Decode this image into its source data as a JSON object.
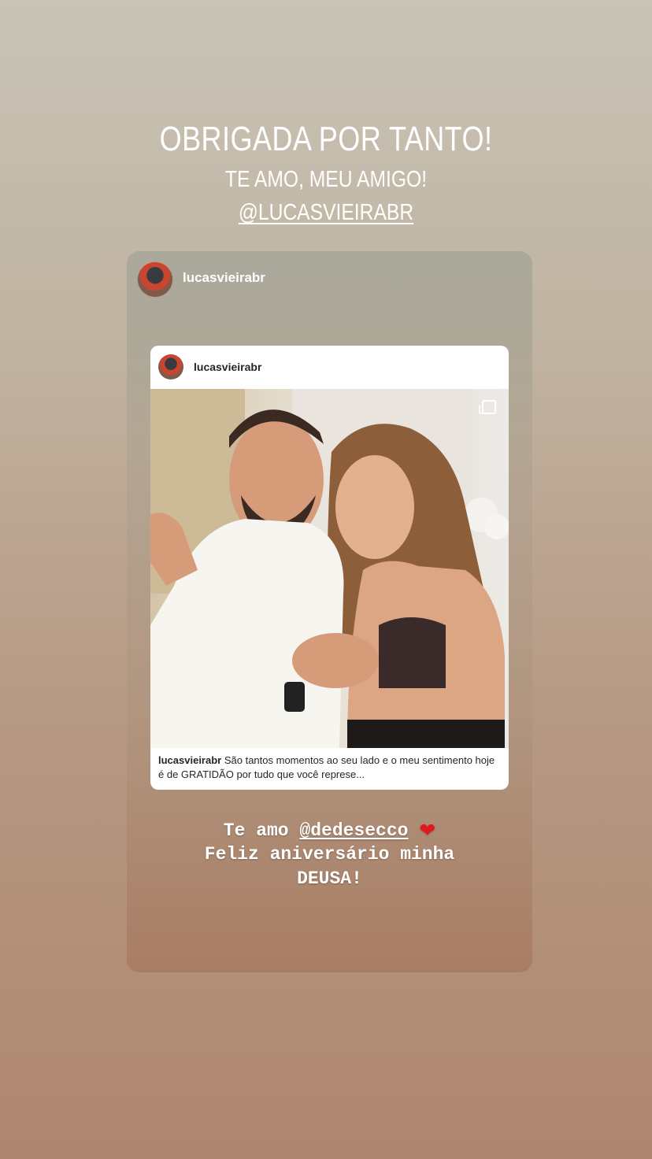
{
  "story": {
    "headline": "OBRIGADA POR TANTO!",
    "subline": "TE AMO, MEU AMIGO!",
    "mention": "@LUCASVIEIRABR"
  },
  "shared_post": {
    "username": "lucasvieirabr",
    "post_username": "lucasvieirabr",
    "caption_user": "lucasvieirabr",
    "caption_text": "São tantos momentos ao seu lado e o meu sentimento hoje é de GRATIDÃO por tudo que você represe...",
    "message_line1_prefix": "Te amo ",
    "message_mention": "@dedesecco",
    "message_heart": "❤",
    "message_line2": "Feliz aniversário minha",
    "message_line3": "DEUSA!"
  },
  "colors": {
    "heart": "#e0191d",
    "background_top": "#c8c3b6",
    "background_bottom": "#ae8670"
  },
  "icons": [
    "avatar",
    "multiple-photos-icon",
    "heart-icon"
  ]
}
